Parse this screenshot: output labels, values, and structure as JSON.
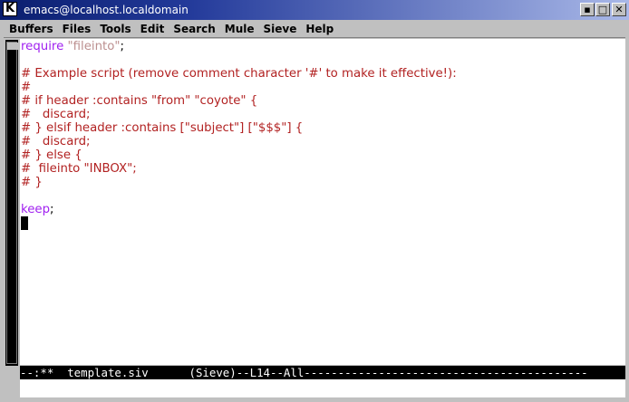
{
  "window": {
    "title": "emacs@localhost.localdomain",
    "app_icon_letter": "K",
    "min_glyph": "▪",
    "max_glyph": "□",
    "close_glyph": "✕"
  },
  "menubar": {
    "items": [
      "Buffers",
      "Files",
      "Tools",
      "Edit",
      "Search",
      "Mule",
      "Sieve",
      "Help"
    ]
  },
  "buffer": {
    "lines": [
      {
        "segments": [
          {
            "t": "require",
            "c": "kw"
          },
          {
            "t": " ",
            "c": "plain"
          },
          {
            "t": "\"fileinto\"",
            "c": "str"
          },
          {
            "t": ";",
            "c": "plain"
          }
        ]
      },
      {
        "segments": []
      },
      {
        "segments": [
          {
            "t": "# Example script (remove comment character '#' to make it effective!):",
            "c": "cmt"
          }
        ]
      },
      {
        "segments": [
          {
            "t": "#",
            "c": "cmt"
          }
        ]
      },
      {
        "segments": [
          {
            "t": "# if header :contains \"from\" \"coyote\" {",
            "c": "cmt"
          }
        ]
      },
      {
        "segments": [
          {
            "t": "#   discard;",
            "c": "cmt"
          }
        ]
      },
      {
        "segments": [
          {
            "t": "# } elsif header :contains [\"subject\"] [\"$$$\"] {",
            "c": "cmt"
          }
        ]
      },
      {
        "segments": [
          {
            "t": "#   discard;",
            "c": "cmt"
          }
        ]
      },
      {
        "segments": [
          {
            "t": "# } else {",
            "c": "cmt"
          }
        ]
      },
      {
        "segments": [
          {
            "t": "#  fileinto \"INBOX\";",
            "c": "cmt"
          }
        ]
      },
      {
        "segments": [
          {
            "t": "# }",
            "c": "cmt"
          }
        ]
      },
      {
        "segments": []
      },
      {
        "segments": [
          {
            "t": "keep",
            "c": "kw"
          },
          {
            "t": ";",
            "c": "plain"
          }
        ]
      },
      {
        "segments": []
      }
    ],
    "cursor_line": 14
  },
  "modeline": {
    "text": "--:**  template.siv      (Sieve)--L14--All------------------------------------------"
  },
  "colors": {
    "keyword": "#a020f0",
    "string": "#bc8f8f",
    "comment": "#b22222",
    "titlebar_start": "#0a1e6e",
    "titlebar_end": "#a9b8e8"
  }
}
